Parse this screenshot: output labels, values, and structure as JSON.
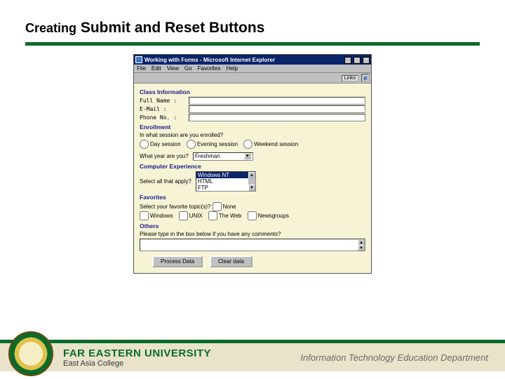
{
  "slide": {
    "title_prefix": "Creating",
    "title_main": " Submit and Reset Buttons"
  },
  "window": {
    "title": "Working with Forms - Microsoft Internet Explorer",
    "menu": [
      "File",
      "Edit",
      "View",
      "Go",
      "Favorites",
      "Help"
    ],
    "links_label": "Links",
    "ie_glyph": "e"
  },
  "form": {
    "class_info": {
      "heading": "Class Information",
      "fields": [
        {
          "label": "Full Name :",
          "value": ""
        },
        {
          "label": "E-Mail    :",
          "value": ""
        },
        {
          "label": "Phone No. :",
          "value": ""
        }
      ]
    },
    "enrollment": {
      "heading": "Enrollment",
      "q1": "In what session are you enrolled?",
      "options": [
        "Day session",
        "Evening session",
        "Weekend session"
      ],
      "q2": "What year are you?",
      "year_selected": "Freshman"
    },
    "experience": {
      "heading": "Computer Experience",
      "label": "Select all that apply?",
      "items": [
        "Windows NT",
        "HTML",
        "FTP"
      ]
    },
    "favorites": {
      "heading": "Favorites",
      "label": "Select your favorite topic(s)?",
      "checks": [
        "None",
        "Windows",
        "UNIX",
        "The Web",
        "Newsgroups"
      ]
    },
    "others": {
      "heading": "Others",
      "label": "Please type in the box below if you have any comments?",
      "value": ""
    },
    "buttons": {
      "submit": "Process Data",
      "reset": "Clear data"
    }
  },
  "footer": {
    "uni_line1": "FAR EASTERN UNIVERSITY",
    "uni_line2": "East Asia College",
    "dept": "Information Technology Education Department"
  }
}
